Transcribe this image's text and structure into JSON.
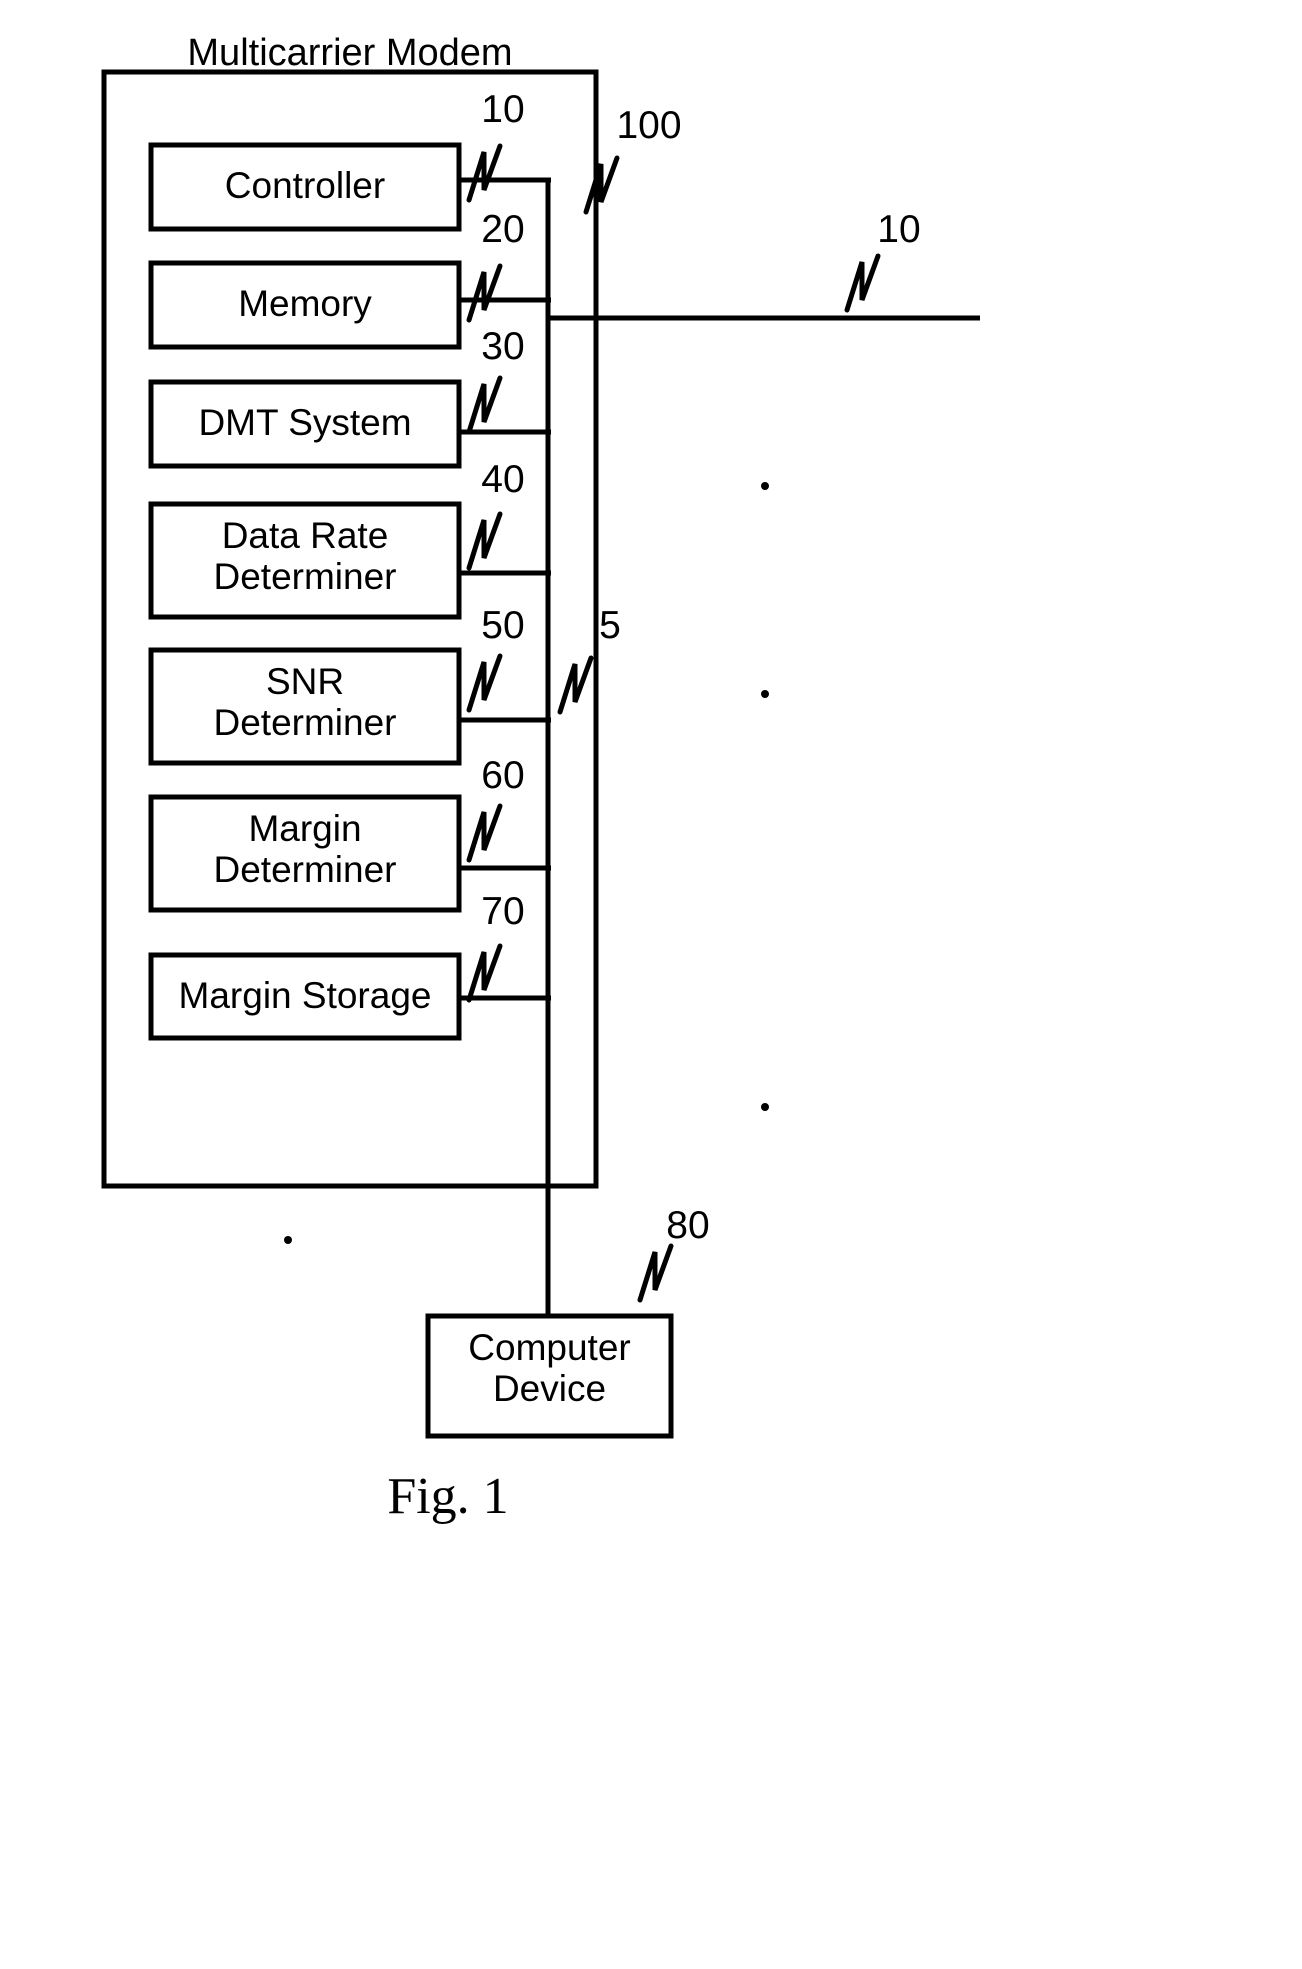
{
  "figure": {
    "title": "Multicarrier Modem",
    "caption": "Fig. 1"
  },
  "blocks": [
    {
      "id": "controller",
      "label": "Controller",
      "ref": "10"
    },
    {
      "id": "memory",
      "label": "Memory",
      "ref": "20"
    },
    {
      "id": "dmt-system",
      "label": "DMT System",
      "ref": "30"
    },
    {
      "id": "data-rate-determiner",
      "label": "Data Rate\nDeterminer",
      "ref": "40"
    },
    {
      "id": "snr-determiner",
      "label": "SNR\nDeterminer",
      "ref": "50"
    },
    {
      "id": "margin-determiner",
      "label": "Margin\nDeterminer",
      "ref": "60"
    },
    {
      "id": "margin-storage",
      "label": "Margin Storage",
      "ref": "70"
    },
    {
      "id": "computer-device",
      "label": "Computer\nDevice",
      "ref": "80"
    }
  ],
  "refs": {
    "modem_enclosure": "100",
    "bus": "5",
    "external_line": "10"
  },
  "colors": {
    "stroke": "#000000",
    "background": "#ffffff"
  }
}
